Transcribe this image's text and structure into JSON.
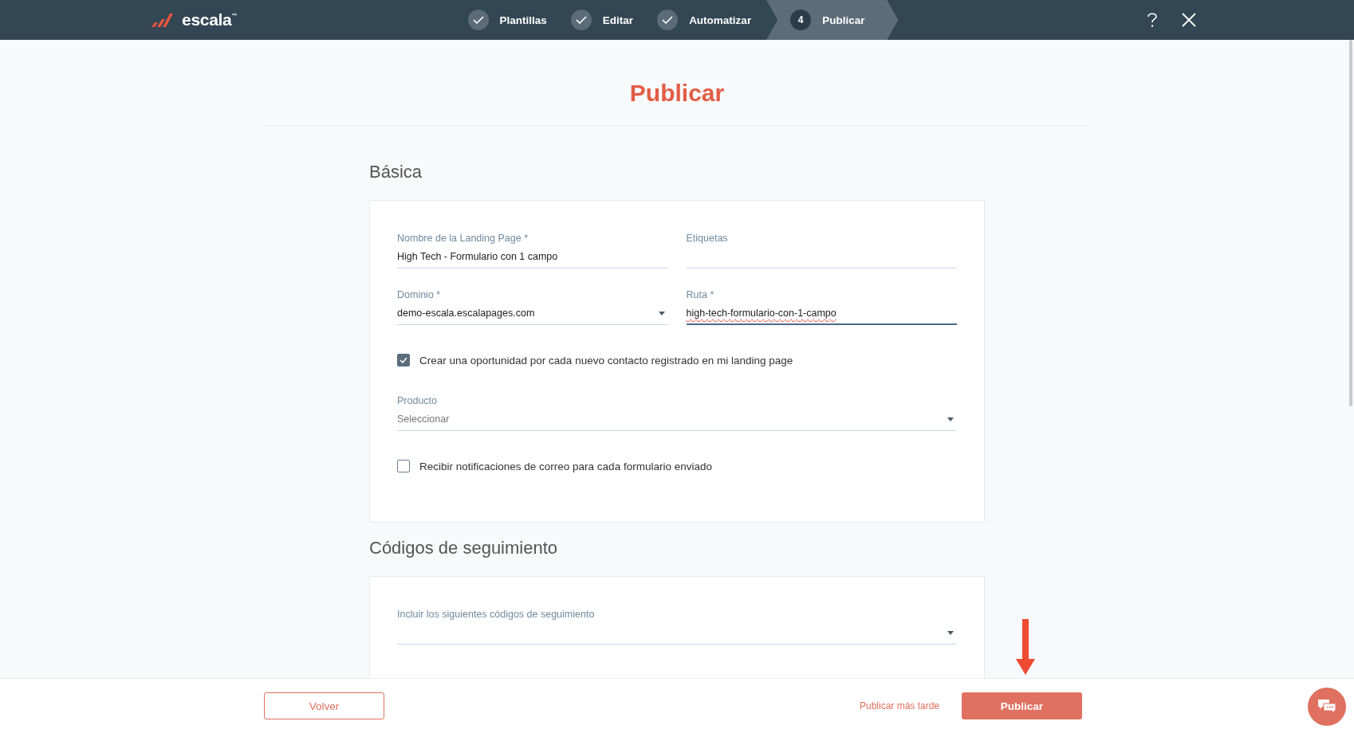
{
  "header": {
    "logo": "escala",
    "logo_mark": "™",
    "steps": [
      {
        "label": "Plantillas",
        "done": true,
        "selected": false
      },
      {
        "label": "Editar",
        "done": true,
        "selected": false
      },
      {
        "label": "Automatizar",
        "done": true,
        "selected": false
      },
      {
        "number": "4",
        "label": "Publicar",
        "done": false,
        "selected": true
      }
    ]
  },
  "page_title": "Publicar",
  "sections": [
    {
      "title": "Básica",
      "rows": [
        [
          {
            "kind": "text",
            "label": "Nombre de la Landing Page *",
            "value": "High Tech - Formulario con 1 campo",
            "focused": false,
            "misspelled": false
          },
          {
            "kind": "text",
            "label": "Etiquetas",
            "focused": false
          }
        ],
        [
          {
            "kind": "select",
            "label": "Dominio *",
            "value": "demo-escala.escalapages.com"
          },
          {
            "kind": "text",
            "label": "Ruta *",
            "value": "high-tech-formulario-con-1-campo",
            "focused": true,
            "misspelled": true
          }
        ],
        [
          {
            "kind": "checkbox",
            "label": "Crear una oportunidad por cada nuevo contacto registrado en mi landing page",
            "checked": true
          }
        ],
        [
          {
            "kind": "select",
            "label": "Producto",
            "placeholder": "Seleccionar"
          }
        ],
        [
          {
            "kind": "checkbox",
            "label": "Recibir notificaciones de correo para cada formulario enviado",
            "checked": false
          }
        ]
      ]
    },
    {
      "title": "Códigos de seguimiento",
      "rows": [
        [
          {
            "kind": "select",
            "label": "Incluir los siguientes códigos de seguimiento"
          }
        ]
      ]
    }
  ],
  "footer": {
    "back": "Volver",
    "later": "Publicar más tarde",
    "publish": "Publicar"
  }
}
